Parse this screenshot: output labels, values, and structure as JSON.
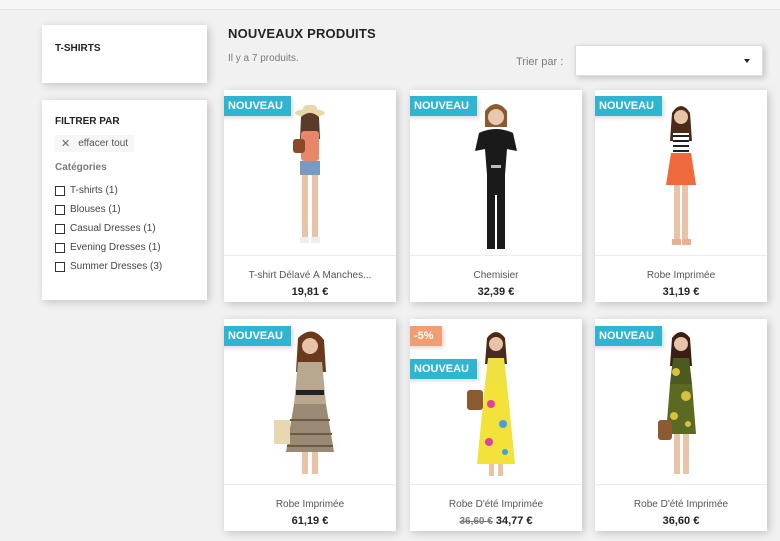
{
  "category_block": {
    "title": "T-SHIRTS"
  },
  "filters": {
    "title": "FILTRER PAR",
    "clear_all": "effacer tout",
    "group_title": "Catégories",
    "items": [
      {
        "label": "T-shirts (1)"
      },
      {
        "label": "Blouses (1)"
      },
      {
        "label": "Casual Dresses (1)"
      },
      {
        "label": "Evening Dresses (1)"
      },
      {
        "label": "Summer Dresses (3)"
      }
    ]
  },
  "listing": {
    "title": "NOUVEAUX PRODUITS",
    "count": "Il y a 7 produits.",
    "sort_label": "Trier par :",
    "sort_value": ""
  },
  "colors": {
    "accent": "#2fb5d2",
    "discount": "#f39d72"
  },
  "products": [
    {
      "name": "T-shirt Délavé À Manches...",
      "price": "19,81 €",
      "flags": [
        "NOUVEAU"
      ]
    },
    {
      "name": "Chemisier",
      "price": "32,39 €",
      "flags": [
        "NOUVEAU"
      ]
    },
    {
      "name": "Robe Imprimée",
      "price": "31,19 €",
      "flags": [
        "NOUVEAU"
      ]
    },
    {
      "name": "Robe Imprimée",
      "price": "61,19 €",
      "flags": [
        "NOUVEAU"
      ]
    },
    {
      "name": "Robe D'été Imprimée",
      "price": "34,77 €",
      "old_price": "36,60 €",
      "flags": [
        "-5%",
        "NOUVEAU"
      ]
    },
    {
      "name": "Robe D'été Imprimée",
      "price": "36,60 €",
      "flags": [
        "NOUVEAU"
      ]
    }
  ]
}
